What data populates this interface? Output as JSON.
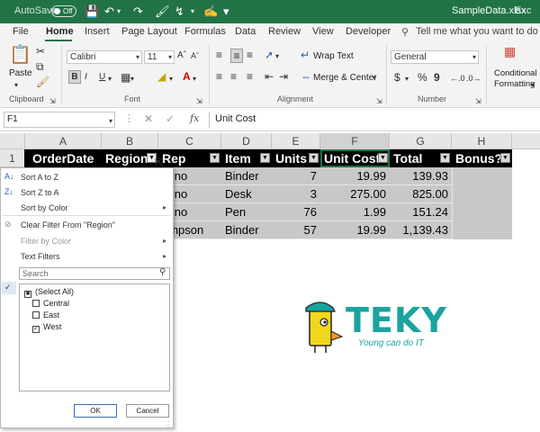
{
  "titlebar": {
    "autosave": "AutoSave",
    "toggle": "Off",
    "filename": "SampleData.xlsx",
    "app": "Exc"
  },
  "tabs": [
    "File",
    "Home",
    "Insert",
    "Page Layout",
    "Formulas",
    "Data",
    "Review",
    "View",
    "Developer"
  ],
  "active_tab": "Home",
  "tell_me": "Tell me what you want to do",
  "ribbon": {
    "paste": "Paste",
    "font_name": "Calibri",
    "font_size": "11",
    "wrap_text": "Wrap Text",
    "merge_center": "Merge & Center",
    "number_format": "General",
    "conditional": "Conditional",
    "formatting": "Formatting",
    "groups": {
      "clipboard": "Clipboard",
      "font": "Font",
      "alignment": "Alignment",
      "number": "Number"
    }
  },
  "formula_bar": {
    "name_box": "F1",
    "formula": "Unit Cost",
    "fx": "fx"
  },
  "columns": [
    "A",
    "B",
    "C",
    "D",
    "E",
    "F",
    "G",
    "H"
  ],
  "rows": [
    "1"
  ],
  "table": {
    "headers": [
      "OrderDate",
      "Region",
      "Rep",
      "Item",
      "Units",
      "Unit Cost",
      "Total",
      "Bonus?"
    ],
    "visible_rows": [
      {
        "rep": "rvino",
        "item": "Binder",
        "units": "7",
        "unit_cost": "19.99",
        "total": "139.93"
      },
      {
        "rep": "rvino",
        "item": "Desk",
        "units": "3",
        "unit_cost": "275.00",
        "total": "825.00"
      },
      {
        "rep": "rvino",
        "item": "Pen",
        "units": "76",
        "unit_cost": "1.99",
        "total": "151.24"
      },
      {
        "rep": "ompson",
        "item": "Binder",
        "units": "57",
        "unit_cost": "19.99",
        "total": "1,139.43"
      }
    ]
  },
  "filter_menu": {
    "sort_az": "Sort A to Z",
    "sort_za": "Sort Z to A",
    "sort_color": "Sort by Color",
    "clear_filter": "Clear Filter From \"Region\"",
    "filter_color": "Filter by Color",
    "text_filters": "Text Filters",
    "search_placeholder": "Search",
    "items": [
      {
        "label": "(Select All)",
        "state": "mixed"
      },
      {
        "label": "Central",
        "state": "unchecked"
      },
      {
        "label": "East",
        "state": "unchecked"
      },
      {
        "label": "West",
        "state": "checked"
      }
    ],
    "ok": "OK",
    "cancel": "Cancel"
  },
  "logo": {
    "brand": "TEKY",
    "tagline": "Young can do IT"
  },
  "colors": {
    "excel_green": "#217346",
    "header_black": "#000000",
    "data_grey": "#c8c8c8",
    "logo_teal": "#1aa3a0",
    "logo_yellow": "#f2d71c"
  }
}
